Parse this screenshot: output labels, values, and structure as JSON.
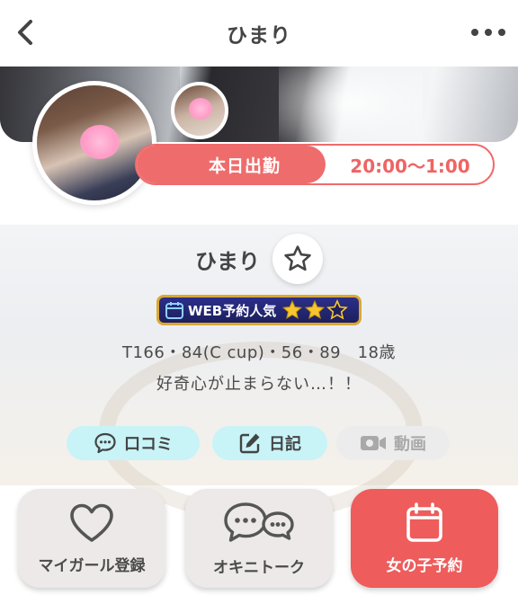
{
  "header": {
    "title": "ひまり",
    "back_icon": "chevron-left-icon",
    "more_icon": "more-horizontal-icon"
  },
  "schedule": {
    "today_label": "本日出勤",
    "hours": "20:00〜1:00"
  },
  "profile": {
    "name": "ひまり",
    "badge_text": "WEB予約人気",
    "badge_rating": 2,
    "badge_rating_max": 3,
    "stats": "T166・84(C cup)・56・89　18歳",
    "catchphrase": "好奇心が止まらない…！！"
  },
  "chips": {
    "reviews": "口コミ",
    "diary": "日記",
    "video": "動画"
  },
  "actions": {
    "mygirl": "マイガール登録",
    "talk": "オキニトーク",
    "reserve": "女の子予約"
  },
  "colors": {
    "accent_red": "#ef6c6c",
    "chip_cyan": "#c8f3f7",
    "badge_navy": "#1d1f5e",
    "badge_gold": "#d9a834"
  }
}
